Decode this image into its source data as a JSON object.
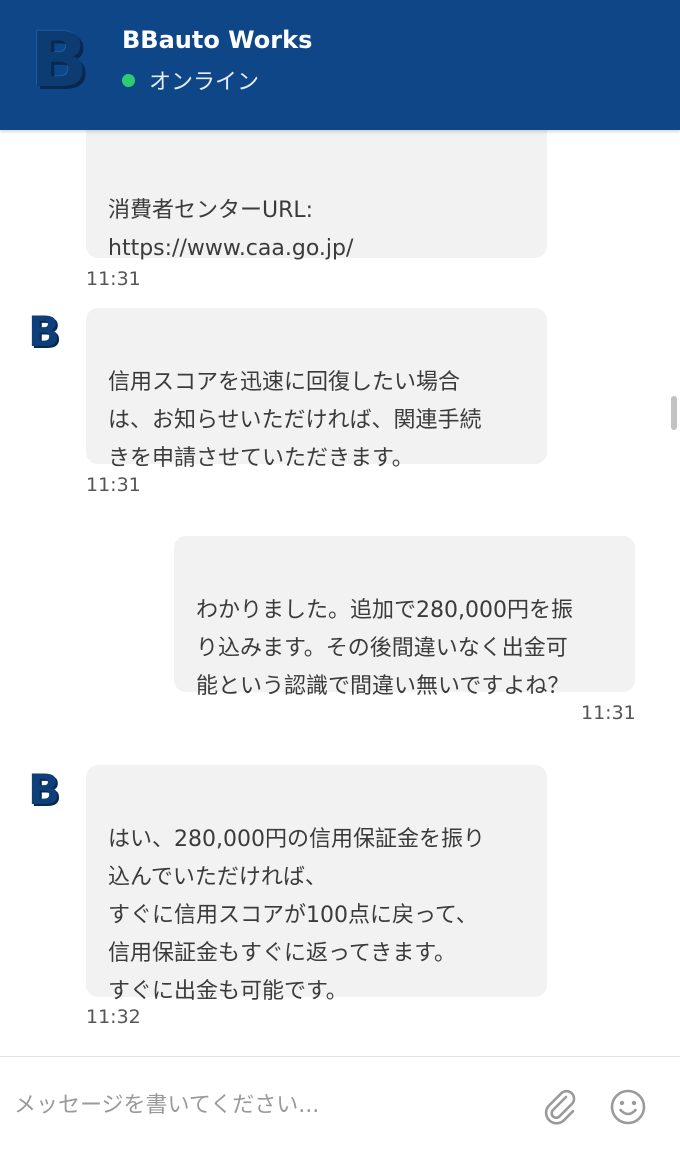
{
  "header": {
    "logo_letter": "B",
    "title": "BBauto Works",
    "status": "オンライン",
    "status_color": "#2ecc71",
    "brand_color": "#0f4688"
  },
  "messages": [
    {
      "side": "received",
      "text": "消費者センターURL:\nhttps://www.caa.go.jp/",
      "time": "11:31"
    },
    {
      "side": "received",
      "text": "信用スコアを迅速に回復したい場合\nは、お知らせいただければ、関連手続\nきを申請させていただきます。",
      "time": "11:31"
    },
    {
      "side": "sent",
      "text": "わかりました。追加で280,000円を振\nり込みます。その後間違いなく出金可\n能という認識で間違い無いですよね？",
      "time": "11:31"
    },
    {
      "side": "received",
      "text": "はい、280,000円の信用保証金を振り\n込んでいただければ、\nすぐに信用スコアが100点に戻って、\n信用保証金もすぐに返ってきます。\nすぐに出金も可能です。",
      "time": "11:32"
    }
  ],
  "composer": {
    "placeholder": "メッセージを書いてください...",
    "attach_icon": "paperclip-icon",
    "emoji_icon": "smiley-icon"
  }
}
